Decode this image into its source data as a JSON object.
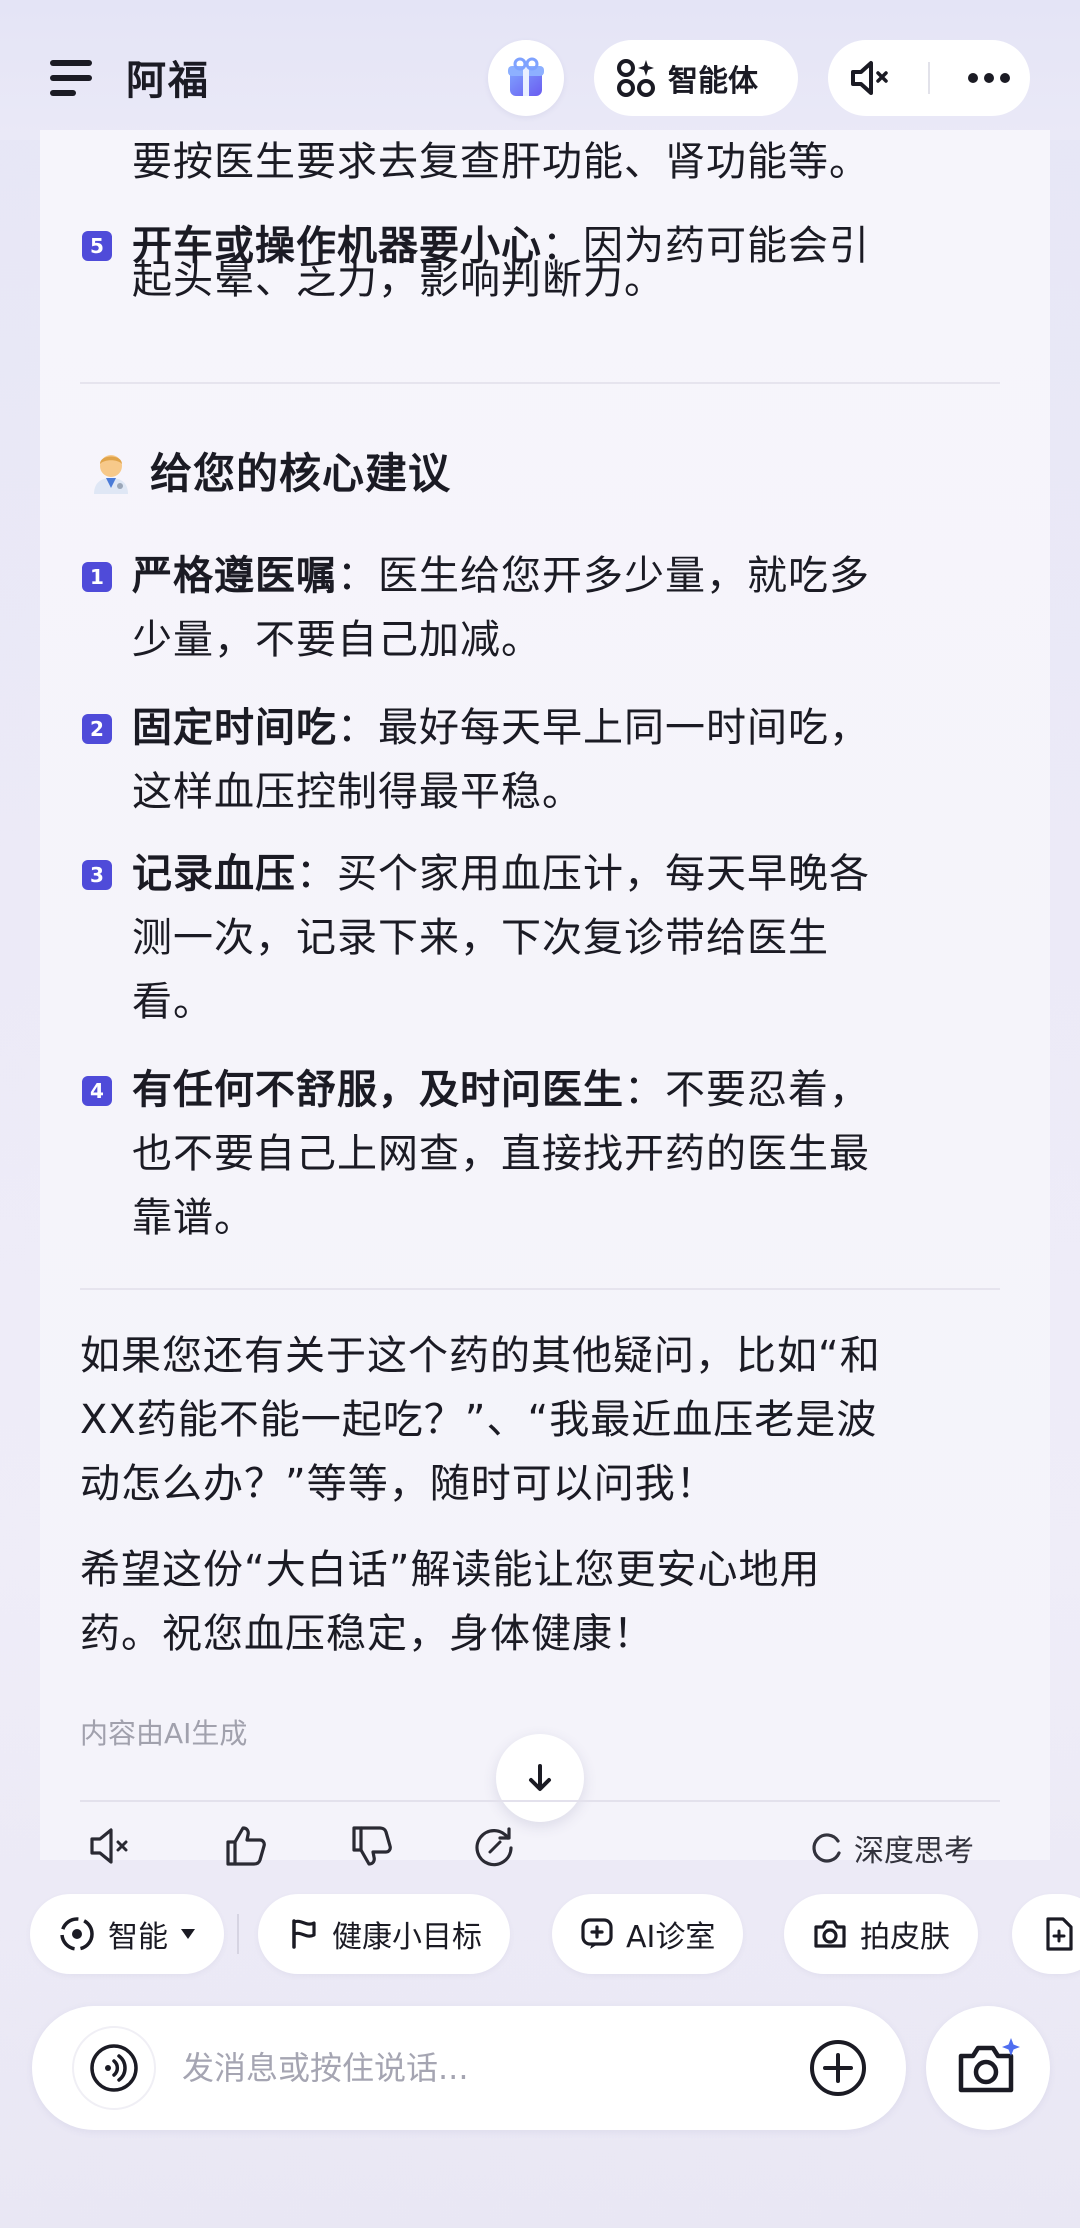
{
  "header": {
    "title": "阿福",
    "agent_label": "智能体"
  },
  "message": {
    "cont_line": "要按医生要求去复查肝功能、肾功能等。",
    "prev_item": {
      "num": "5",
      "bold": "开车或操作机器要小心",
      "text_l1": "：因为药可能会引",
      "text_l2": "起头晕、乏力，影响判断力。"
    },
    "section_title": "给您的核心建议",
    "items": [
      {
        "num": "1",
        "bold": "严格遵医嘱",
        "l1": "：医生给您开多少量，就吃多",
        "l2": "少量，不要自己加减。",
        "l3": ""
      },
      {
        "num": "2",
        "bold": "固定时间吃",
        "l1": "：最好每天早上同一时间吃，",
        "l2": "这样血压控制得最平稳。",
        "l3": ""
      },
      {
        "num": "3",
        "bold": "记录血压",
        "l1": "：买个家用血压计，每天早晚各",
        "l2": "测一次，记录下来，下次复诊带给医生",
        "l3": "看。"
      },
      {
        "num": "4",
        "bold": "有任何不舒服，及时问医生",
        "l1": "：不要忍着，",
        "l2": "也不要自己上网查，直接找开药的医生最",
        "l3": "靠谱。"
      }
    ],
    "para1": [
      "如果您还有关于这个药的其他疑问，比如“和",
      "XX药能不能一起吃？”、“我最近血压老是波",
      "动怎么办？”等等，随时可以问我！"
    ],
    "para2": [
      "希望这份“大白话”解读能让您更安心地用",
      "药。祝您血压稳定，身体健康！"
    ],
    "ai_note": "内容由AI生成"
  },
  "actions": {
    "deep_think_label": "深度思考"
  },
  "chips": {
    "mode_label": "智能",
    "items": [
      "健康小目标",
      "AI诊室",
      "拍皮肤"
    ]
  },
  "input": {
    "placeholder": "发消息或按住说话..."
  },
  "colors": {
    "accent": "#4f4bd9",
    "badge": "#4f4bd9",
    "muted_text": "#a1a1ad"
  }
}
